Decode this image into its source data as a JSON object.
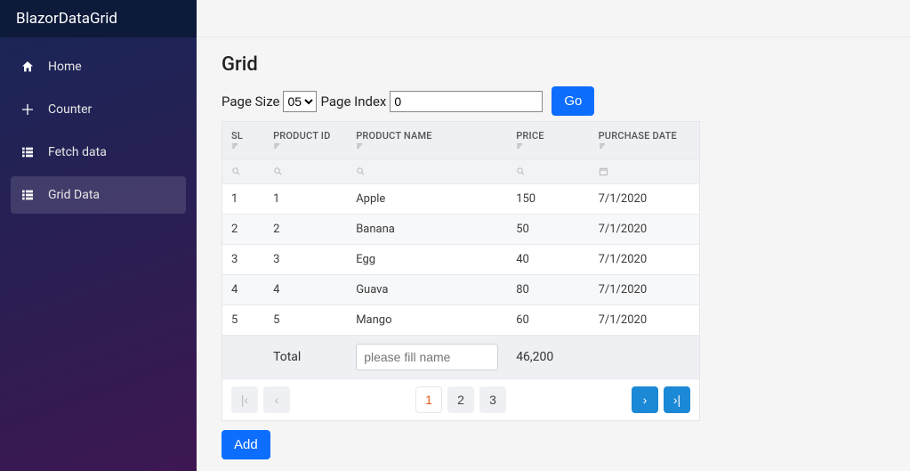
{
  "brand": "BlazorDataGrid",
  "sidebar": {
    "items": [
      {
        "label": "Home",
        "icon": "home-icon",
        "active": false
      },
      {
        "label": "Counter",
        "icon": "plus-icon",
        "active": false
      },
      {
        "label": "Fetch data",
        "icon": "list-icon",
        "active": false
      },
      {
        "label": "Grid Data",
        "icon": "list-icon",
        "active": true
      }
    ]
  },
  "page": {
    "title": "Grid",
    "page_size_label": "Page Size",
    "page_size_options": [
      "05"
    ],
    "page_size_value": "05",
    "page_index_label": "Page Index",
    "page_index_value": "0",
    "go_label": "Go",
    "add_label": "Add"
  },
  "grid": {
    "columns": [
      {
        "key": "sl",
        "label": "SL"
      },
      {
        "key": "product_id",
        "label": "PRODUCT ID"
      },
      {
        "key": "product_name",
        "label": "PRODUCT NAME"
      },
      {
        "key": "price",
        "label": "PRICE"
      },
      {
        "key": "purchase_date",
        "label": "PURCHASE DATE"
      }
    ],
    "rows": [
      {
        "sl": "1",
        "product_id": "1",
        "product_name": "Apple",
        "price": "150",
        "purchase_date": "7/1/2020"
      },
      {
        "sl": "2",
        "product_id": "2",
        "product_name": "Banana",
        "price": "50",
        "purchase_date": "7/1/2020"
      },
      {
        "sl": "3",
        "product_id": "3",
        "product_name": "Egg",
        "price": "40",
        "purchase_date": "7/1/2020"
      },
      {
        "sl": "4",
        "product_id": "4",
        "product_name": "Guava",
        "price": "80",
        "purchase_date": "7/1/2020"
      },
      {
        "sl": "5",
        "product_id": "5",
        "product_name": "Mango",
        "price": "60",
        "purchase_date": "7/1/2020"
      }
    ],
    "footer": {
      "label": "Total",
      "name_placeholder": "please fill name",
      "total_price": "46,200"
    }
  },
  "pager": {
    "pages": [
      "1",
      "2",
      "3"
    ],
    "current": "1"
  }
}
